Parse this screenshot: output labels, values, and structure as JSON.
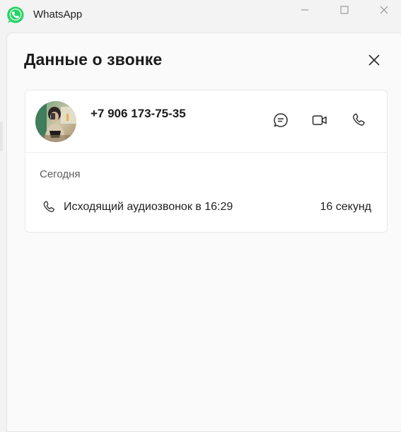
{
  "window": {
    "app_name": "WhatsApp",
    "controls": {
      "minimize_icon": "minimize-icon",
      "maximize_icon": "maximize-icon",
      "close_icon": "close-icon"
    }
  },
  "panel": {
    "title": "Данные о звонке",
    "close_icon": "close-icon"
  },
  "contact": {
    "phone": "+7 906 173-75-35",
    "avatar": "contact-photo",
    "actions": [
      {
        "icon": "chat-icon"
      },
      {
        "icon": "video-call-icon"
      },
      {
        "icon": "voice-call-icon"
      }
    ]
  },
  "history": {
    "day": "Сегодня",
    "calls": [
      {
        "icon": "phone-icon",
        "description": "Исходящий аудиозвонок в 16:29",
        "duration": "16 секунд"
      }
    ]
  },
  "colors": {
    "brand": "#25d366",
    "background": "#f3f3f3",
    "panel": "#fafafa",
    "card": "#ffffff"
  }
}
